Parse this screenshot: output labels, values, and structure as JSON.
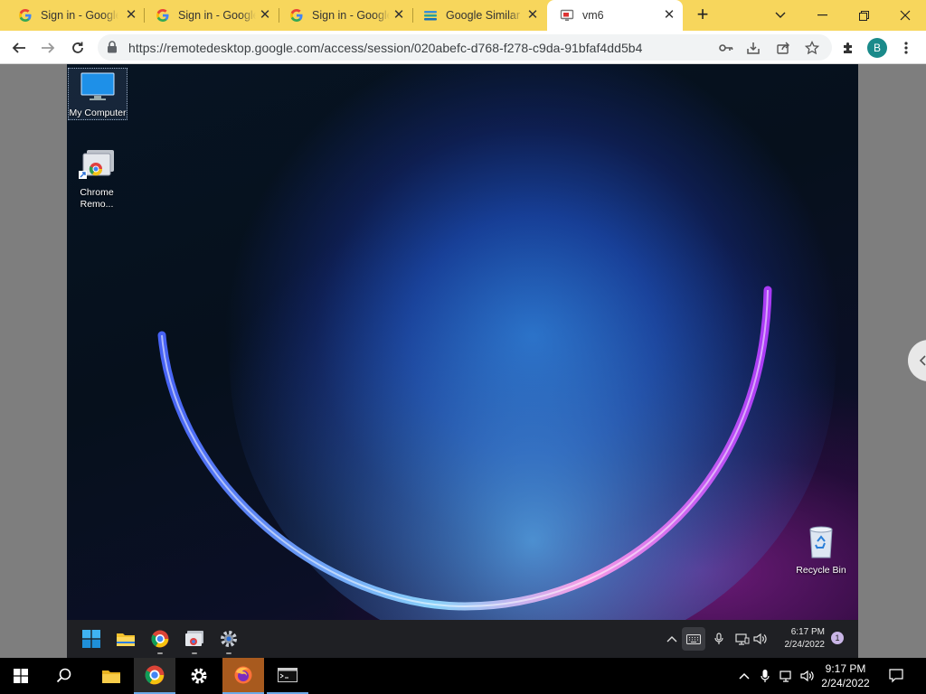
{
  "browser": {
    "tabs": [
      {
        "title": "Sign in - Google Accounts",
        "favicon": "google-g-icon",
        "active": false
      },
      {
        "title": "Sign in - Google Accounts",
        "favicon": "google-g-icon",
        "active": false
      },
      {
        "title": "Sign in - Google Accounts",
        "favicon": "google-g-icon",
        "active": false
      },
      {
        "title": "Google Similar Pages",
        "favicon": "layers-icon",
        "active": false
      },
      {
        "title": "vm6",
        "favicon": "remote-desktop-icon",
        "active": true
      }
    ],
    "new_tab_label": "+",
    "url": "https://remotedesktop.google.com/access/session/020abefc-d768-f278-c9da-91bfaf4dd5b4",
    "profile_initial": "B",
    "colors": {
      "tabstrip": "#f7d65c",
      "profile": "#1a8a8a"
    }
  },
  "remote": {
    "desktop_icons": [
      {
        "label": "My Computer"
      },
      {
        "label": "Chrome Remo..."
      },
      {
        "label": "Recycle Bin"
      }
    ],
    "chrome_label_lines": [
      "Chrome",
      "Remo..."
    ],
    "clock": {
      "time": "6:17 PM",
      "date": "2/24/2022"
    },
    "notification_count": "1"
  },
  "host": {
    "clock": {
      "time": "9:17 PM",
      "date": "2/24/2022"
    }
  }
}
